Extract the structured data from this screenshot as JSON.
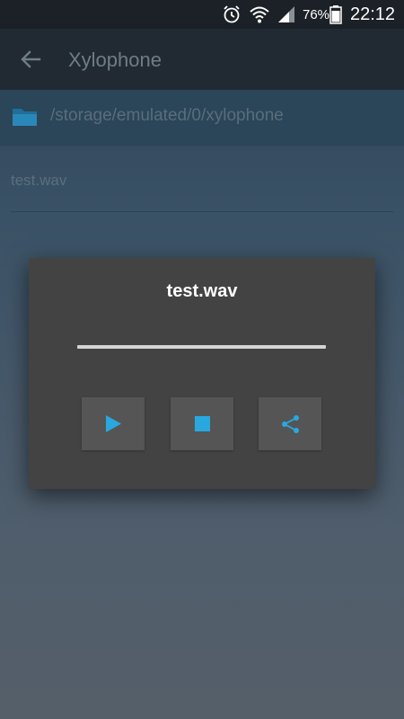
{
  "status_bar": {
    "battery_percent": "76%",
    "time": "22:12",
    "icons": [
      "alarm-icon",
      "wifi-icon",
      "signal-icon",
      "battery-icon"
    ]
  },
  "app_bar": {
    "title": "Xylophone",
    "back_icon": "arrow-back-icon"
  },
  "browser": {
    "path": "/storage/emulated/0/xylophone",
    "folder_icon": "folder-icon",
    "files": [
      {
        "name": "test.wav"
      }
    ]
  },
  "player_dialog": {
    "title": "test.wav",
    "progress": 0,
    "buttons": [
      {
        "name": "play-button",
        "icon": "play-icon"
      },
      {
        "name": "stop-button",
        "icon": "stop-icon"
      },
      {
        "name": "share-button",
        "icon": "share-icon"
      }
    ]
  },
  "colors": {
    "accent": "#29a8e0",
    "dialog_background": "#434343",
    "button_background": "#555555",
    "status_bar": "#1b2127",
    "app_bar": "#212a32"
  }
}
